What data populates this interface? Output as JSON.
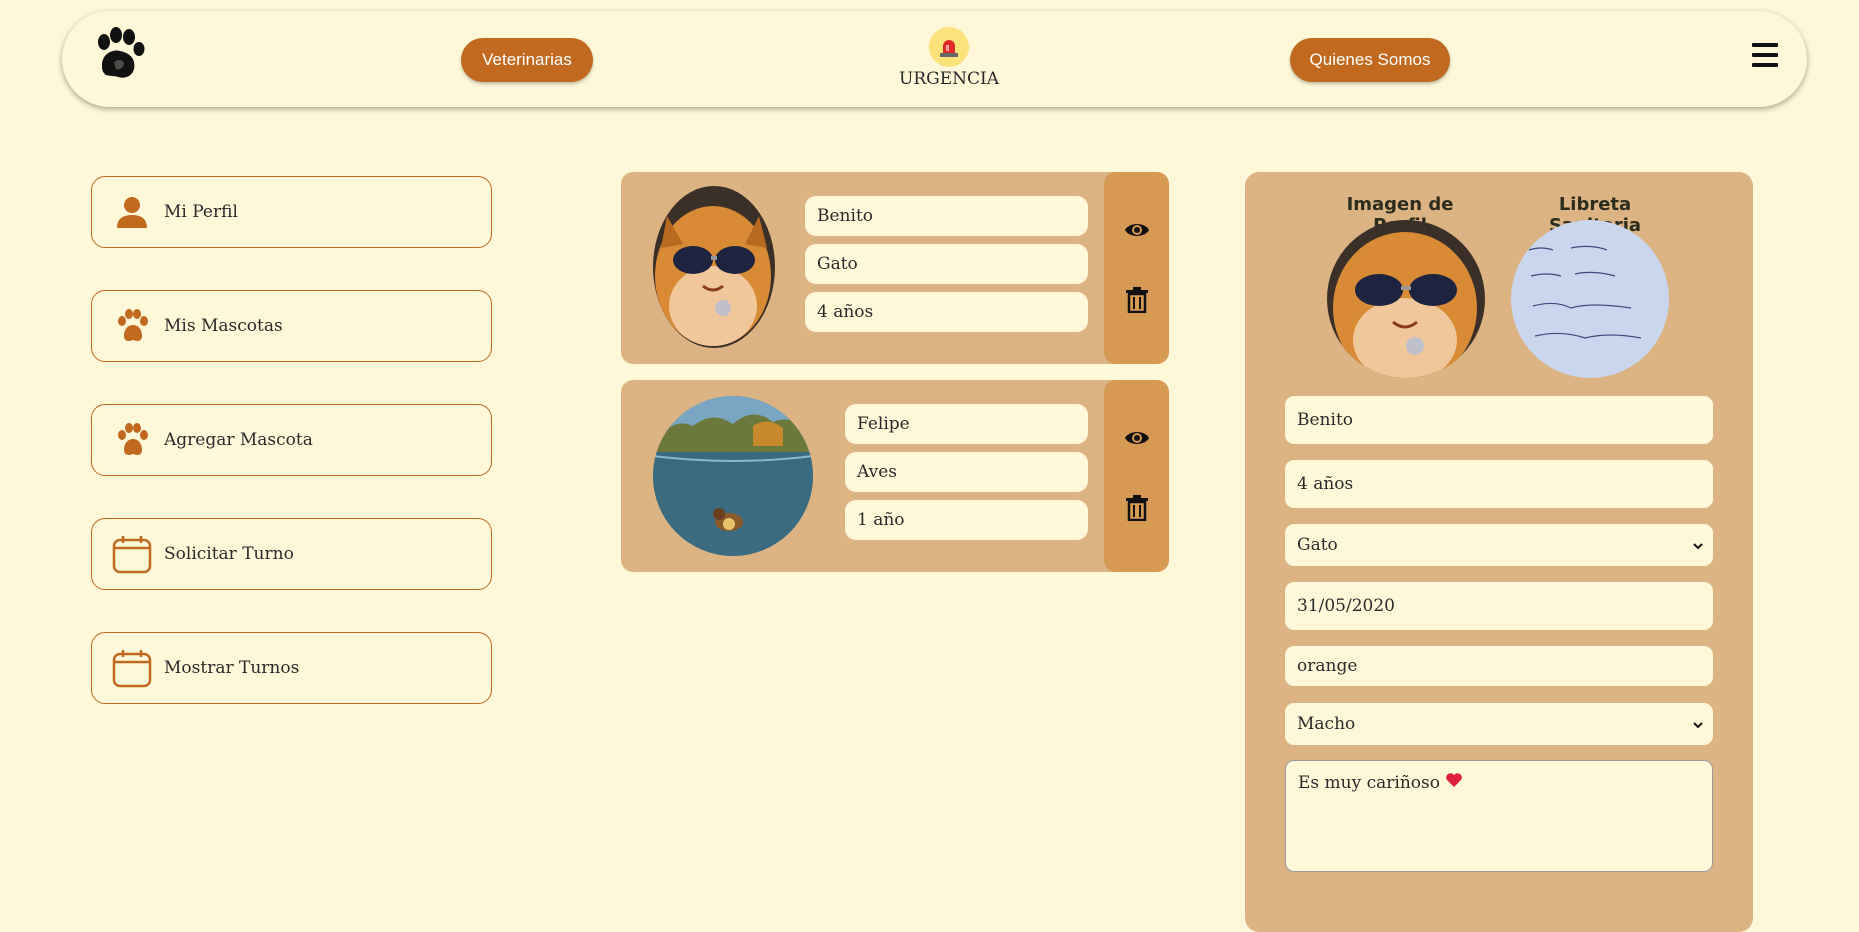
{
  "nav": {
    "veterinarias": "Veterinarias",
    "urgencia": "URGENCIA",
    "quienes_somos": "Quienes Somos"
  },
  "menu": [
    {
      "label": "Mi Perfil",
      "icon": "user-icon"
    },
    {
      "label": "Mis Mascotas",
      "icon": "paw-icon"
    },
    {
      "label": "Agregar Mascota",
      "icon": "paw-icon"
    },
    {
      "label": "Solicitar Turno",
      "icon": "calendar-icon"
    },
    {
      "label": "Mostrar Turnos",
      "icon": "calendar-icon"
    }
  ],
  "pets": [
    {
      "name": "Benito",
      "species": "Gato",
      "age": "4 años"
    },
    {
      "name": "Felipe",
      "species": "Aves",
      "age": "1 año"
    }
  ],
  "detail": {
    "profile_image_label": "Imagen de Perfil",
    "health_book_label": "Libreta Sanitaria",
    "name": "Benito",
    "age": "4 años",
    "species": "Gato",
    "birthdate": "31/05/2020",
    "color": "orange",
    "sex": "Macho",
    "notes": "Es muy cariñoso"
  },
  "colors": {
    "background": "#fef8d8",
    "accent": "#c0691f",
    "card": "#dcb483",
    "card_actions": "#d79a55"
  }
}
